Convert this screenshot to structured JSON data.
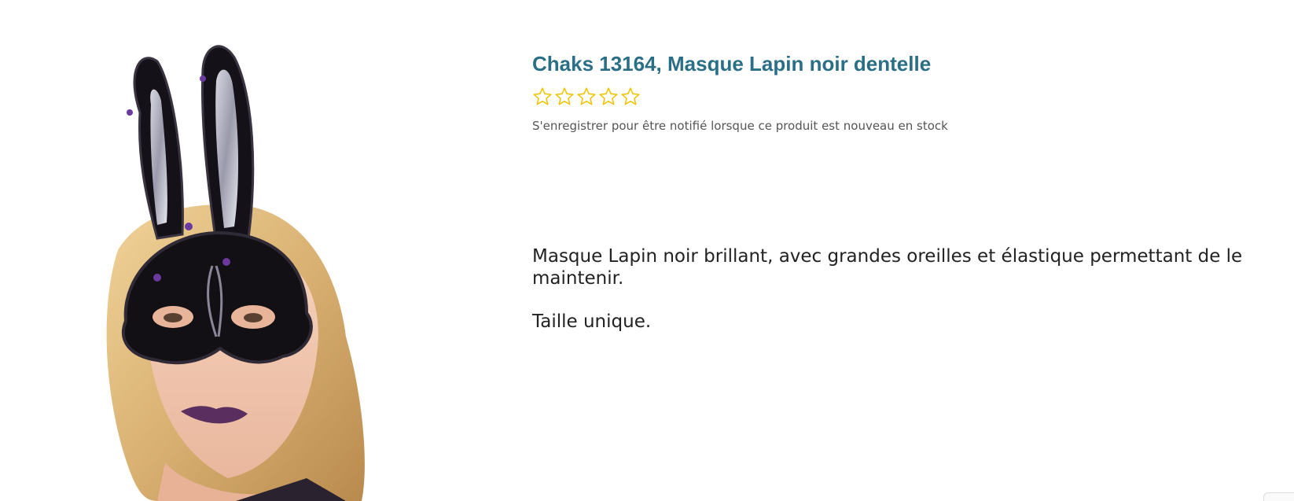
{
  "product": {
    "image_alt": "Masque Lapin noir dentelle",
    "title": "Chaks 13164, Masque Lapin noir dentelle",
    "rating": {
      "value": 0,
      "max": 5,
      "star_color": "#f2c300"
    },
    "notify_text": "S'enregistrer pour être notifié lorsque ce produit est nouveau en stock",
    "description": [
      "Masque Lapin noir brillant, avec grandes oreilles et élastique permettant de le maintenir.",
      "Taille unique."
    ]
  },
  "colors": {
    "title": "#2a6f85",
    "text": "#222222",
    "muted": "#555555"
  }
}
